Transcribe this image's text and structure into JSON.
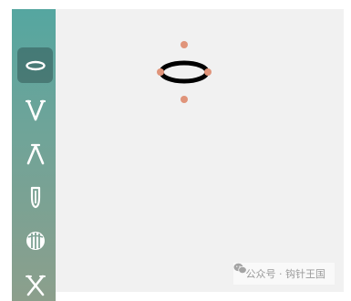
{
  "toolbar": {
    "tools": [
      {
        "name": "ellipse-tool",
        "icon": "ellipse-outline-icon",
        "selected": true
      },
      {
        "name": "v-shape-tool",
        "icon": "v-shape-icon",
        "selected": false
      },
      {
        "name": "lambda-shape-tool",
        "icon": "lambda-shape-icon",
        "selected": false
      },
      {
        "name": "elongated-drop-tool",
        "icon": "elongated-drop-icon",
        "selected": false
      },
      {
        "name": "striped-sphere-tool",
        "icon": "striped-sphere-icon",
        "selected": false
      },
      {
        "name": "x-shape-tool",
        "icon": "x-shape-icon",
        "selected": false
      }
    ]
  },
  "canvas": {
    "shape": "ellipse",
    "handles": [
      "top",
      "left",
      "right",
      "bottom"
    ],
    "handle_color": "#e0947a",
    "stroke_color": "#000000"
  },
  "colors": {
    "sidebar_top": "#55a6a0",
    "sidebar_bottom": "#8c9f8c",
    "canvas_bg": "#f1f1f1"
  },
  "watermark": {
    "icon": "wechat-icon",
    "text": "公众号 · 钩针王国"
  }
}
